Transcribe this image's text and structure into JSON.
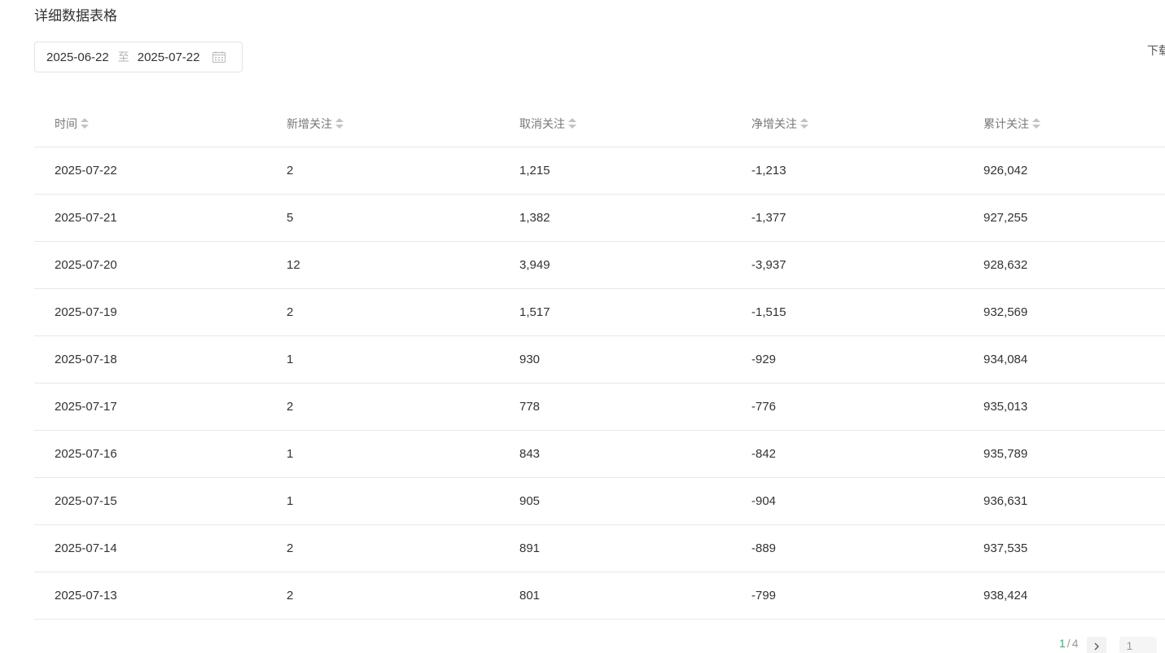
{
  "section": {
    "title": "详细数据表格"
  },
  "date_range": {
    "start": "2025-06-22",
    "separator": "至",
    "end": "2025-07-22",
    "icon": "calendar-icon"
  },
  "download": {
    "label": "下载"
  },
  "table": {
    "headers": [
      "时间",
      "新增关注",
      "取消关注",
      "净增关注",
      "累计关注"
    ],
    "sort_icon": "sort-icon",
    "rows": [
      [
        "2025-07-22",
        "2",
        "1,215",
        "-1,213",
        "926,042"
      ],
      [
        "2025-07-21",
        "5",
        "1,382",
        "-1,377",
        "927,255"
      ],
      [
        "2025-07-20",
        "12",
        "3,949",
        "-3,937",
        "928,632"
      ],
      [
        "2025-07-19",
        "2",
        "1,517",
        "-1,515",
        "932,569"
      ],
      [
        "2025-07-18",
        "1",
        "930",
        "-929",
        "934,084"
      ],
      [
        "2025-07-17",
        "2",
        "778",
        "-776",
        "935,013"
      ],
      [
        "2025-07-16",
        "1",
        "843",
        "-842",
        "935,789"
      ],
      [
        "2025-07-15",
        "1",
        "905",
        "-904",
        "936,631"
      ],
      [
        "2025-07-14",
        "2",
        "891",
        "-889",
        "937,535"
      ],
      [
        "2025-07-13",
        "2",
        "801",
        "-799",
        "938,424"
      ]
    ]
  },
  "pagination": {
    "current": "1",
    "separator": "/",
    "total": "4",
    "next_icon": "chevron-right-icon",
    "input_value": "1"
  },
  "colors": {
    "accent": "#2bb673",
    "border": "#e8e8e8",
    "header_text": "#777777"
  }
}
